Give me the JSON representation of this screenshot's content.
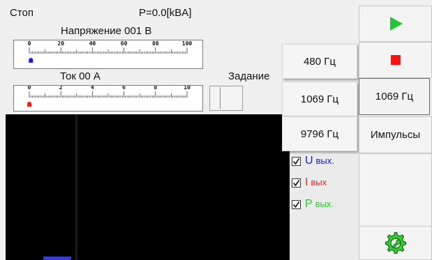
{
  "status": {
    "state": "Стоп",
    "power": "P=0.0[kBA]"
  },
  "voltage_gauge": {
    "title": "Напряжение 001 В",
    "ticks": [
      "0",
      "20",
      "40",
      "60",
      "80",
      "100"
    ],
    "value": 1,
    "max": 100,
    "marker_color": "#1a1aff"
  },
  "current_gauge": {
    "title": "Ток 00 А",
    "ticks": [
      "0",
      "2",
      "4",
      "6",
      "8",
      "10"
    ],
    "value": 0,
    "max": 10,
    "marker_color": "#ff1a1a"
  },
  "setpoint": {
    "label": "Задание"
  },
  "frequency_buttons": [
    "480 Гц",
    "1069 Гц",
    "9796 Гц"
  ],
  "right_panel": {
    "start_icon": "play-icon",
    "stop_icon": "stop-icon",
    "selected_frequency": "1069 Гц",
    "mode_label": "Импульсы",
    "settings_icon": "gear-wrench-icon"
  },
  "channels": [
    {
      "prefix": "U",
      "suffix": "вых.",
      "checked": true,
      "color": "#1c1ce0"
    },
    {
      "prefix": "I",
      "suffix": "вых",
      "checked": true,
      "color": "#ff1c1c"
    },
    {
      "prefix": "P",
      "suffix": "вых.",
      "checked": true,
      "color": "#28c828"
    }
  ],
  "colors": {
    "play": "#22c832",
    "stop": "#ff1010",
    "gear": "#2fd02f"
  }
}
